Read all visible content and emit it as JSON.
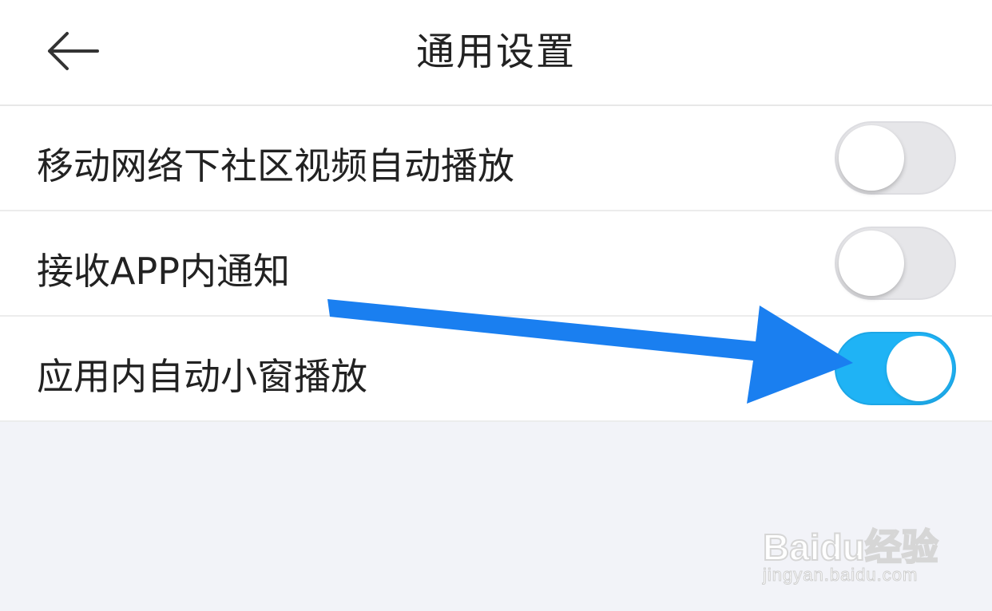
{
  "header": {
    "title": "通用设置",
    "back_icon": "arrow-left-icon"
  },
  "settings": [
    {
      "label": "移动网络下社区视频自动播放",
      "enabled": false
    },
    {
      "label": "接收APP内通知",
      "enabled": false
    },
    {
      "label": "应用内自动小窗播放",
      "enabled": true
    }
  ],
  "colors": {
    "toggle_on": "#1fb3f5",
    "toggle_off": "#e6e6e9",
    "annotation_arrow": "#1a7ff0",
    "background": "#f2f3f8"
  },
  "watermark": {
    "logo": "Baidu经验",
    "url": "jingyan.baidu.com"
  }
}
